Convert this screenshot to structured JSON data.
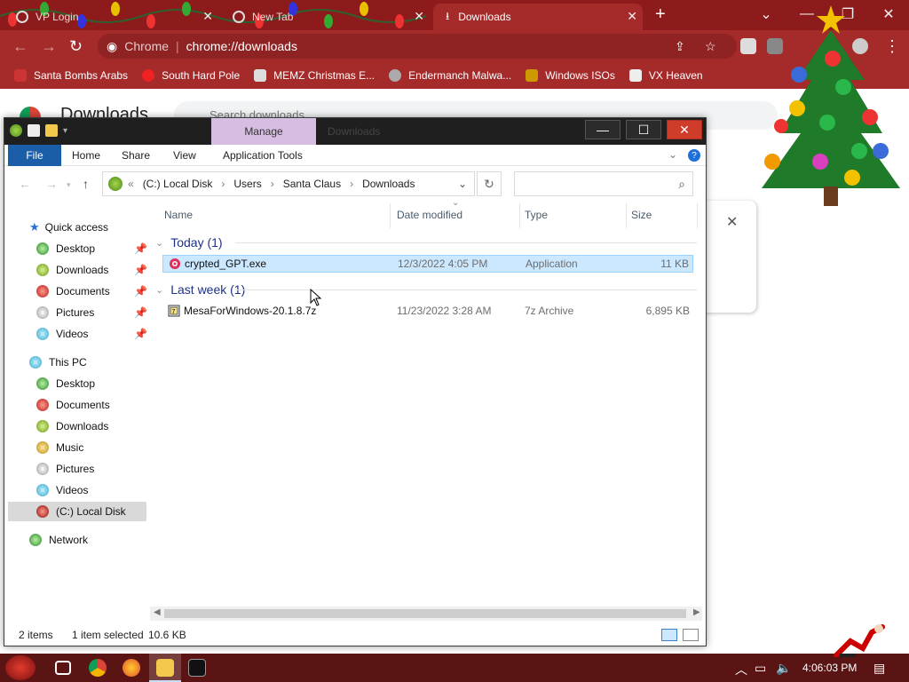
{
  "browser": {
    "tabs": [
      {
        "title": "VP Login",
        "active": false
      },
      {
        "title": "New Tab",
        "active": false
      },
      {
        "title": "Downloads",
        "active": true
      }
    ],
    "new_tab": "+",
    "omnibox": {
      "site": "Chrome",
      "url": "chrome://downloads"
    },
    "bookmarks": [
      "Santa Bombs Arabs",
      "South Hard Pole",
      "MEMZ Christmas E...",
      "Endermanch Malwa...",
      "Windows ISOs",
      "VX Heaven"
    ],
    "page": {
      "title": "Downloads",
      "search_placeholder": "Search downloads"
    }
  },
  "explorer": {
    "title": "Downloads",
    "context_tab": "Manage",
    "ribbon_tabs": [
      "File",
      "Home",
      "Share",
      "View",
      "Application Tools"
    ],
    "breadcrumb_prefix": "«",
    "breadcrumb": [
      "(C:) Local Disk",
      "Users",
      "Santa Claus",
      "Downloads"
    ],
    "columns": [
      "Name",
      "Date modified",
      "Type",
      "Size"
    ],
    "groups": [
      {
        "label": "Today (1)",
        "files": [
          {
            "name": "crypted_GPT.exe",
            "date": "12/3/2022 4:05 PM",
            "type": "Application",
            "size": "11 KB",
            "selected": true
          }
        ]
      },
      {
        "label": "Last week (1)",
        "files": [
          {
            "name": "MesaForWindows-20.1.8.7z",
            "date": "11/23/2022 3:28 AM",
            "type": "7z Archive",
            "size": "6,895 KB",
            "selected": false
          }
        ]
      }
    ],
    "nav": {
      "quick_access": "Quick access",
      "quick_items": [
        "Desktop",
        "Downloads",
        "Documents",
        "Pictures",
        "Videos"
      ],
      "this_pc": "This PC",
      "pc_items": [
        "Desktop",
        "Documents",
        "Downloads",
        "Music",
        "Pictures",
        "Videos",
        "(C:) Local Disk"
      ],
      "network": "Network"
    },
    "status": {
      "items": "2 items",
      "selected": "1 item selected",
      "size": "10.6 KB"
    }
  },
  "taskbar": {
    "clock": "4:06:03 PM"
  },
  "colors": {
    "browser_frame": "#a52a2a",
    "selection": "#cce8ff",
    "file_tab": "#1a5ea8",
    "manage_tab": "#d7bde2",
    "close_btn": "#d03c2a"
  }
}
